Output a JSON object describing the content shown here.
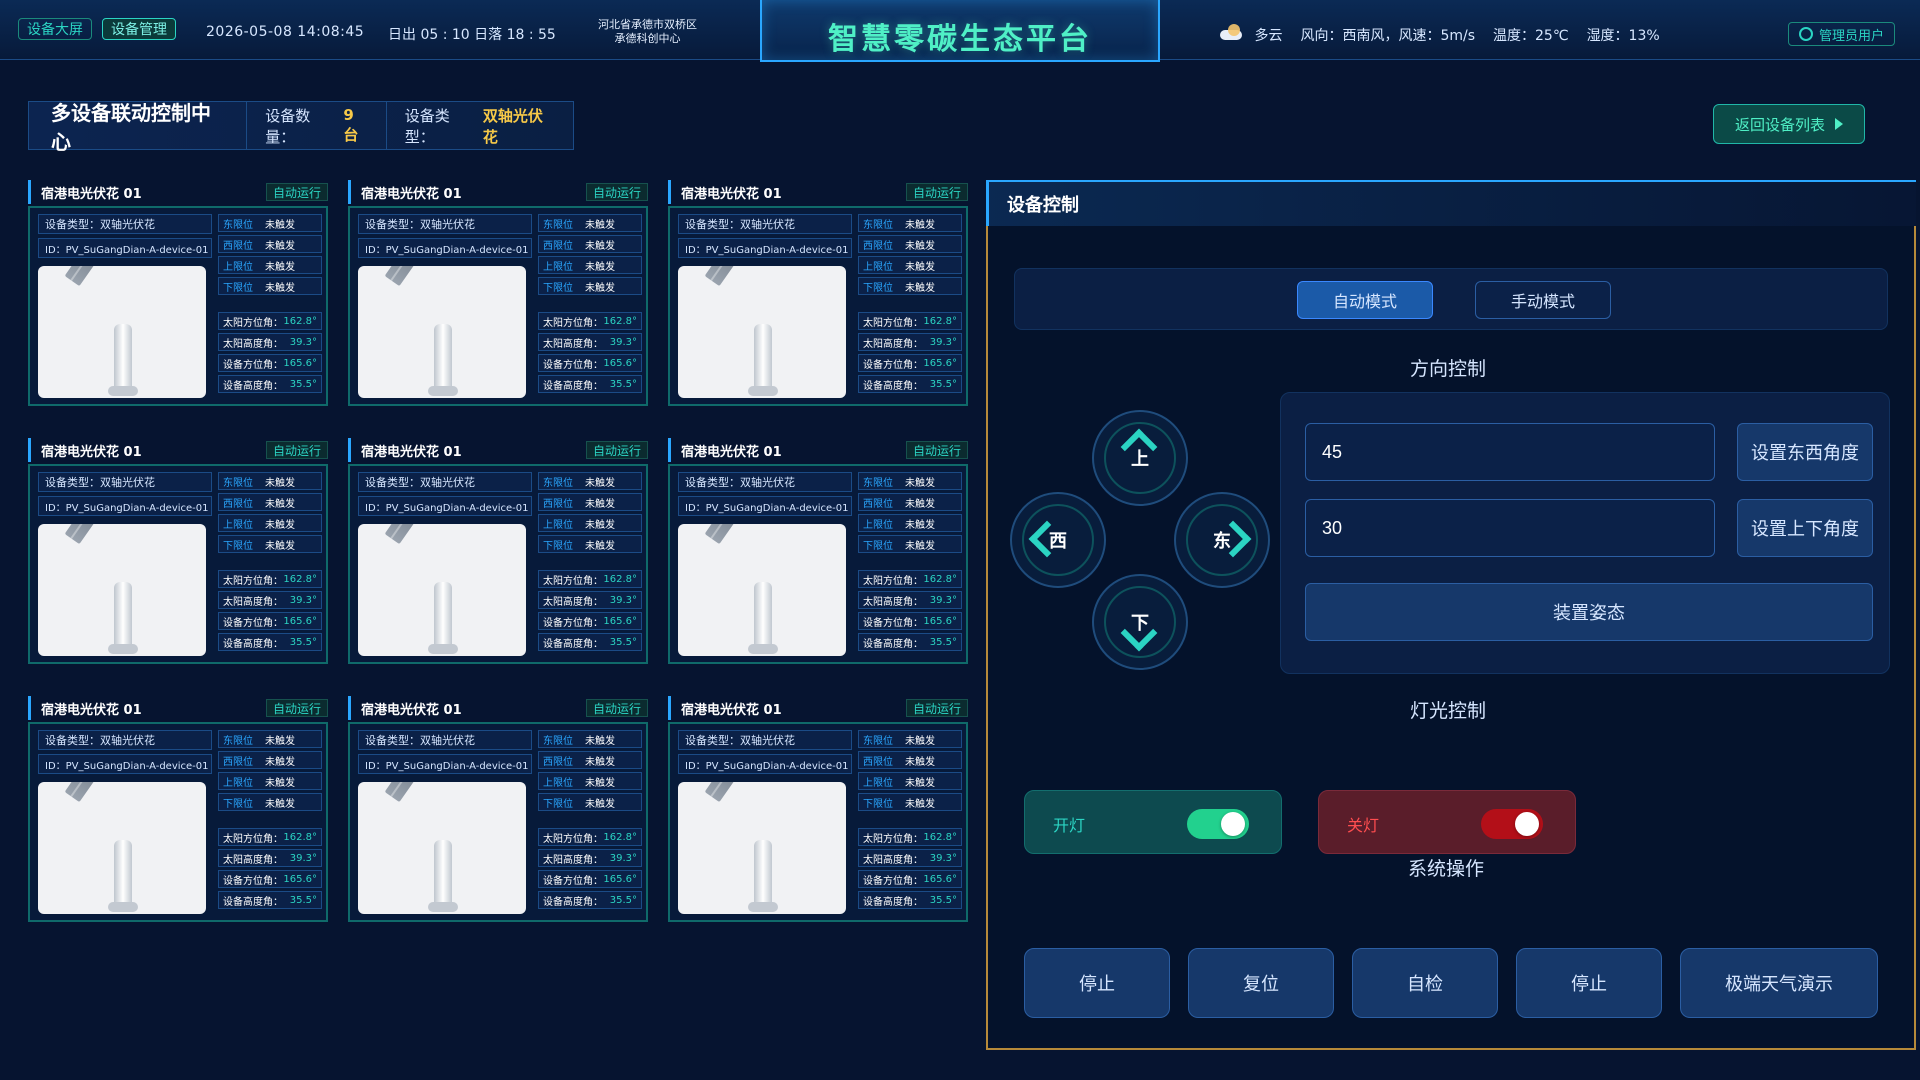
{
  "header": {
    "nav": {
      "screen": "设备大屏",
      "manage": "设备管理"
    },
    "datetime": "2026-05-08  14:08:45",
    "sun": "日出 05 : 10  日落 18 : 55",
    "location_line1": "河北省承德市双桥区",
    "location_line2": "承德科创中心",
    "title": "智慧零碳生态平台",
    "weather": {
      "condition": "多云",
      "wind": "风向：西南风，风速：5m/s",
      "temperature": "温度：25℃",
      "humidity": "湿度：13%"
    },
    "user": "管理员用户"
  },
  "topbar": {
    "title": "多设备联动控制中心",
    "device_count_label": "设备数量：",
    "device_count_value": "9台",
    "device_type_label": "设备类型：",
    "device_type_value": "双轴光伏花",
    "back_button": "返回设备列表"
  },
  "device_card": {
    "name": "宿港电光伏花 01",
    "status": "自动运行",
    "type": "设备类型：双轴光伏花",
    "id": "ID：PV_SuGangDian-A-device-01",
    "limits": [
      {
        "k": "东限位",
        "v": "未触发"
      },
      {
        "k": "西限位",
        "v": "未触发"
      },
      {
        "k": "上限位",
        "v": "未触发"
      },
      {
        "k": "下限位",
        "v": "未触发"
      }
    ],
    "metrics": [
      {
        "k": "太阳方位角：",
        "v": "162.8°"
      },
      {
        "k": "太阳高度角：",
        "v": "39.3°"
      },
      {
        "k": "设备方位角：",
        "v": "165.6°"
      },
      {
        "k": "设备高度角：",
        "v": "35.5°"
      }
    ]
  },
  "control": {
    "title": "设备控制",
    "modes": {
      "auto": "自动模式",
      "manual": "手动模式"
    },
    "direction_title": "方向控制",
    "dpad": {
      "up": "上",
      "down": "下",
      "west": "西",
      "east": "东"
    },
    "ew_value": "45",
    "ud_value": "30",
    "set_ew": "设置东西角度",
    "set_ud": "设置上下角度",
    "pose": "装置姿态",
    "light_title": "灯光控制",
    "light_on": "开灯",
    "light_off": "关灯",
    "system_title": "系统操作",
    "sys_buttons": [
      "停止",
      "复位",
      "自检",
      "停止",
      "极端天气演示"
    ]
  }
}
